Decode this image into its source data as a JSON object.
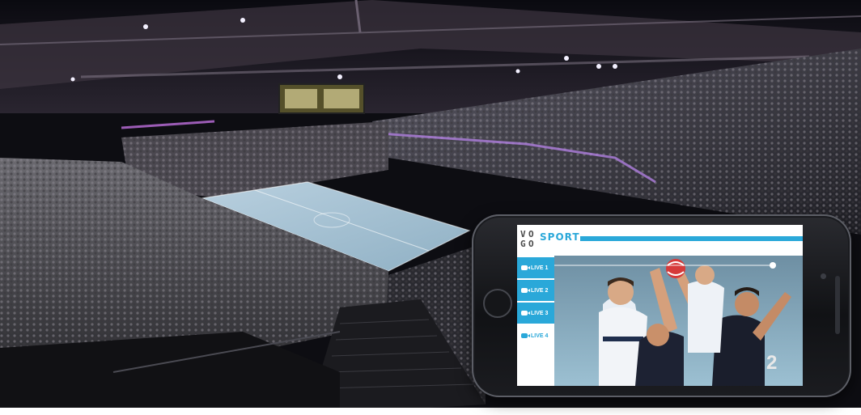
{
  "app": {
    "logo_letters": [
      "V",
      "O",
      "G",
      "O"
    ],
    "brand_label": "SPORT",
    "accent_color": "#2aa8d9"
  },
  "sidebar": {
    "items": [
      {
        "label": "LIVE 1",
        "icon": "video-camera-icon",
        "active": true
      },
      {
        "label": "LIVE 2",
        "icon": "video-camera-icon",
        "active": true
      },
      {
        "label": "LIVE 3",
        "icon": "video-camera-icon",
        "active": true
      },
      {
        "label": "LIVE 4",
        "icon": "video-camera-icon",
        "active": false
      }
    ]
  },
  "video": {
    "jersey_number": "2"
  }
}
